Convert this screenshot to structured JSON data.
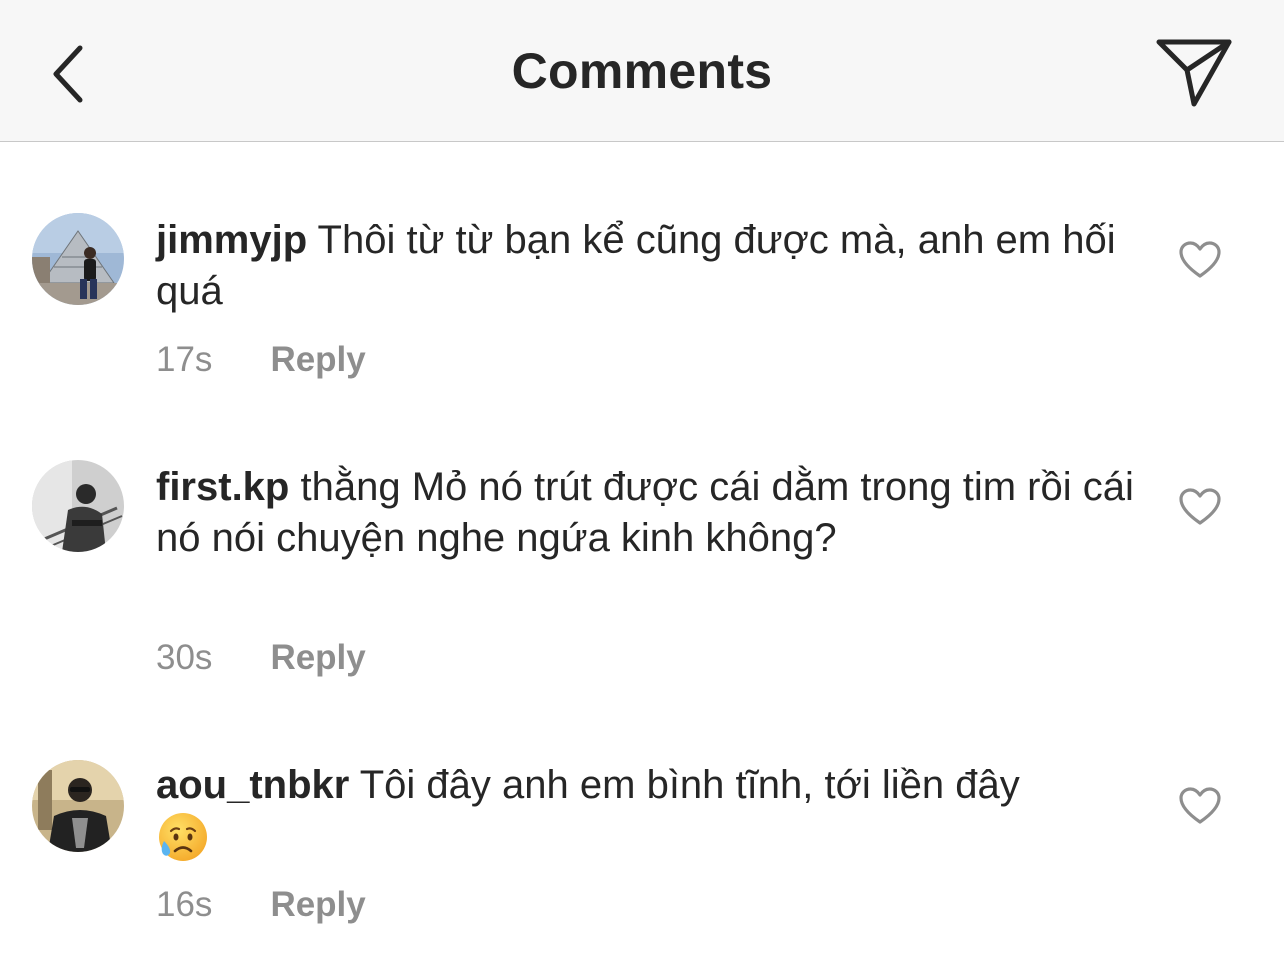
{
  "header": {
    "title": "Comments",
    "back_icon": "chevron-left-icon",
    "send_icon": "paper-plane-icon"
  },
  "comments": [
    {
      "username": "jimmyjp",
      "text": "Thôi từ từ bạn kể cũng được mà, anh em hối quá",
      "time": "17s",
      "reply": "Reply",
      "emoji": ""
    },
    {
      "username": "first.kp",
      "text": "thằng Mỏ nó trút được cái dằm trong tim rồi cái nó nói chuyện nghe ngứa kinh không?",
      "time": "30s",
      "reply": "Reply",
      "emoji": ""
    },
    {
      "username": "aou_tnbkr",
      "text": "Tôi đây anh em bình tĩnh, tới liền đây",
      "time": "16s",
      "reply": "Reply",
      "emoji": "sad-but-relieved-face-emoji"
    }
  ],
  "colors": {
    "text": "#262626",
    "muted": "#8e8e8e",
    "header_bg": "#f7f7f7",
    "divider": "#c8c8c8"
  }
}
